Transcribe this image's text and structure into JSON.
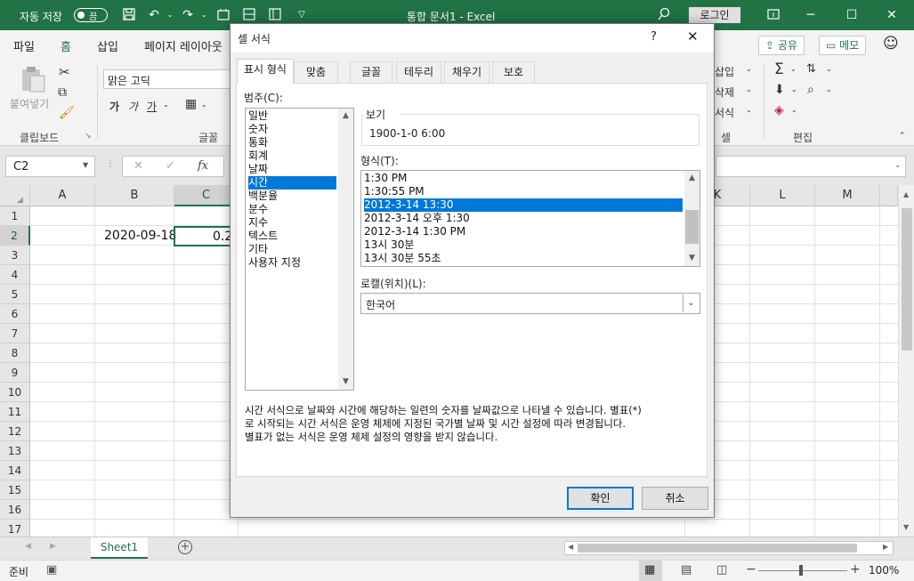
{
  "titlebar": {
    "autosave": "자동 저장",
    "toggle_state": "끔",
    "doc_title": "통합 문서1  -  Excel",
    "login": "로그인"
  },
  "ribbon_tabs": [
    "파일",
    "홈",
    "삽입",
    "페이지 레이아웃"
  ],
  "ribbon_right": {
    "share": "공유",
    "comment": "메모"
  },
  "ribbon": {
    "paste": "붙여넣기",
    "clipboard": "클립보드",
    "font_name": "맑은 고딕",
    "font_group": "글꼴",
    "bold": "가",
    "italic": "가",
    "underline": "가",
    "insert": "삽입",
    "delete": "삭제",
    "format": "서식",
    "cells_group": "셀",
    "editing_group": "편집"
  },
  "formula_bar": {
    "name_box": "C2",
    "fx": "fx"
  },
  "grid": {
    "columns_left": [
      "A",
      "B",
      "C"
    ],
    "columns_right": [
      "K",
      "L",
      "M"
    ],
    "rows": [
      "1",
      "2",
      "3",
      "4",
      "5",
      "6",
      "7",
      "8",
      "9",
      "10",
      "11",
      "12",
      "13",
      "14",
      "15",
      "16",
      "17"
    ],
    "cell_b2": "2020-09-18",
    "cell_c2": "0.2"
  },
  "sheet": {
    "tab": "Sheet1",
    "status": "준비",
    "zoom": "100%"
  },
  "dialog": {
    "title": "셀 서식",
    "help": "?",
    "tabs": [
      "표시 형식",
      "맞춤",
      "글꼴",
      "테두리",
      "채우기",
      "보호"
    ],
    "category_label": "범주(C):",
    "categories": [
      "일반",
      "숫자",
      "통화",
      "회계",
      "날짜",
      "시간",
      "백분율",
      "분수",
      "지수",
      "텍스트",
      "기타",
      "사용자 지정"
    ],
    "selected_category": "시간",
    "sample_label": "보기",
    "sample_value": "1900-1-0 6:00",
    "type_label": "형식(T):",
    "types": [
      "1:30 PM",
      "1:30:55 PM",
      "2012-3-14 13:30",
      "2012-3-14 오후 1:30",
      "2012-3-14 1:30 PM",
      "13시 30분",
      "13시 30분 55초"
    ],
    "selected_type": "2012-3-14 13:30",
    "locale_label": "로캘(위치)(L):",
    "locale_value": "한국어",
    "description": [
      "시간 서식으로 날짜와 시간에 해당하는 일련의 숫자를 날짜값으로 나타낼 수 있습니다. 별표(*)",
      "로 시작되는 시간 서식은 운영 체제에 지정된 국가별 날짜 및 시간 설정에 따라 변경됩니다.",
      "별표가 없는 서식은 운영 체제 설정의 영향을 받지 않습니다."
    ],
    "ok": "확인",
    "cancel": "취소"
  },
  "colors": {
    "excel_green": "#217346",
    "selection_blue": "#0078d7"
  }
}
